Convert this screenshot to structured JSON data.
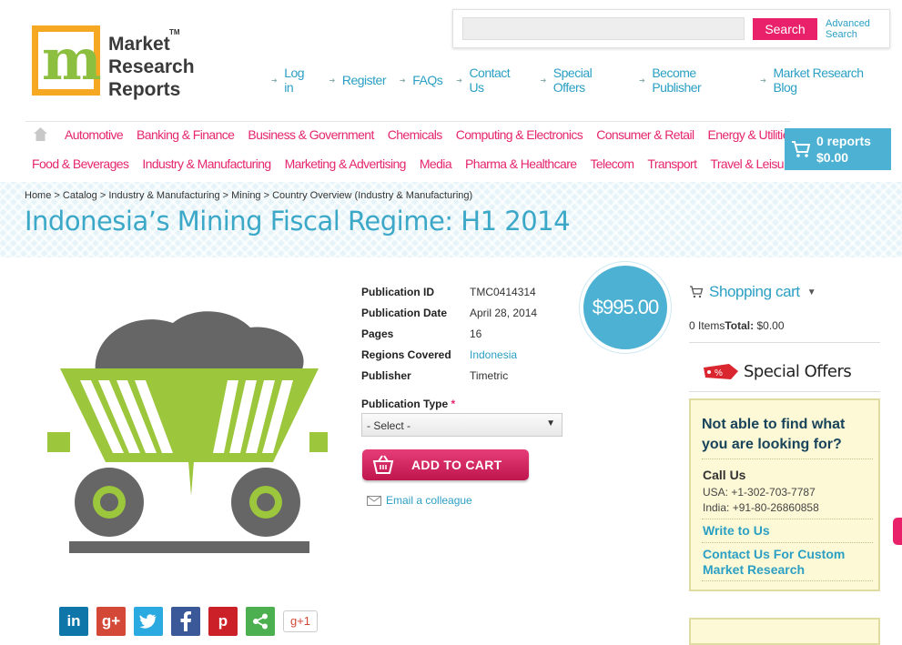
{
  "logo": {
    "text_lines": [
      "Market",
      "Research",
      "Reports"
    ],
    "tm": "TM"
  },
  "search": {
    "placeholder": "",
    "button": "Search",
    "advanced_line1": "Advanced",
    "advanced_line2": "Search"
  },
  "top_nav": [
    "Log in",
    "Register",
    "FAQs",
    "Contact Us",
    "Special Offers",
    "Become Publisher",
    "Market Research Blog"
  ],
  "categories_row1": [
    "Automotive",
    "Banking & Finance",
    "Business & Government",
    "Chemicals",
    "Computing & Electronics",
    "Consumer & Retail",
    "Energy & Utilities"
  ],
  "categories_row2": [
    "Food & Beverages",
    "Industry & Manufacturing",
    "Marketing & Advertising",
    "Media",
    "Pharma & Healthcare",
    "Telecom",
    "Transport",
    "Travel & Leisure"
  ],
  "cart": {
    "reports": "0 reports",
    "total": "$0.00"
  },
  "breadcrumb": "Home > Catalog > Industry & Manufacturing > Mining > Country Overview (Industry & Manufacturing)",
  "title": "Indonesia’s Mining Fiscal Regime: H1 2014",
  "details": [
    {
      "key": "Publication ID",
      "value": "TMC0414314"
    },
    {
      "key": "Publication Date",
      "value": "April 28, 2014"
    },
    {
      "key": "Pages",
      "value": "16"
    },
    {
      "key": "Regions Covered",
      "value": "Indonesia"
    },
    {
      "key": "Publisher",
      "value": "Timetric"
    }
  ],
  "publication_type": {
    "label": "Publication Type",
    "required": "*",
    "selected": "- Select -"
  },
  "add_to_cart": "ADD TO CART",
  "email_colleague": "Email a colleague",
  "price": "$995.00",
  "sidebar": {
    "shopping_cart": "Shopping cart",
    "items_label": "0 Items",
    "total_label": "Total:",
    "total_value": "$0.00",
    "special_offers": "Special Offers",
    "tag_text": "%",
    "help_question": "Not able to find what you are looking for?",
    "call_us": "Call Us",
    "phone_usa": "USA: +1-302-703-7787",
    "phone_india": "India: +91-80-26860858",
    "write_to_us": "Write to Us",
    "contact_custom": "Contact Us For Custom Market Research"
  },
  "social": [
    "in",
    "g+",
    "t",
    "f",
    "p",
    "share",
    "g+1"
  ],
  "colors": {
    "accent_pink": "#e5266d",
    "accent_blue": "#2b9fc4",
    "cart_blue": "#4cb1d2",
    "green": "#9cc63b"
  }
}
